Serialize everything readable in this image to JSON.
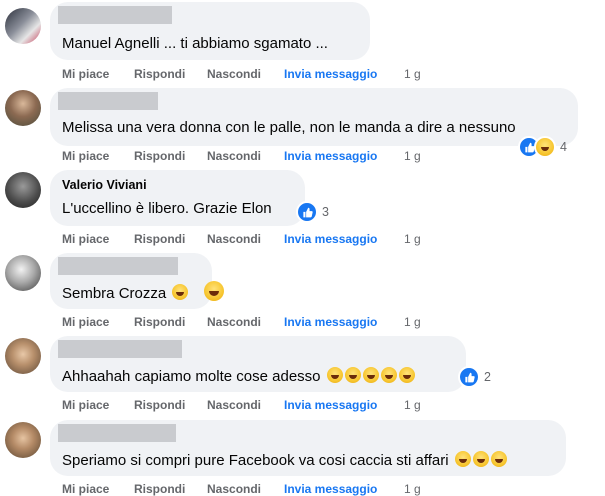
{
  "actions": {
    "like": "Mi piace",
    "reply": "Rispondi",
    "hide": "Nascondi",
    "message": "Invia messaggio",
    "time": "1 g"
  },
  "comments": [
    {
      "author": "",
      "text": "Manuel Agnelli ... ti abbiamo sgamato ...",
      "emoji_in_text": 0,
      "reactions": null
    },
    {
      "author": "",
      "text": "Melissa una vera donna con le palle, non le manda a dire a nessuno",
      "emoji_in_text": 0,
      "reactions": {
        "types": [
          "like",
          "haha"
        ],
        "count": "4"
      }
    },
    {
      "author": "Valerio Viviani",
      "text": "L'uccellino è libero. Grazie Elon",
      "emoji_in_text": 0,
      "reactions": {
        "types": [
          "like"
        ],
        "count": "3"
      }
    },
    {
      "author": "",
      "text": "Sembra Crozza",
      "emoji_in_text": 1,
      "reactions": null
    },
    {
      "author": "",
      "text": "Ahhaahah capiamo molte cose adesso",
      "emoji_in_text": 5,
      "reactions": {
        "types": [
          "like"
        ],
        "count": "2"
      }
    },
    {
      "author": "",
      "text": "Speriamo si compri pure Facebook va cosi caccia sti affari",
      "emoji_in_text": 3,
      "reactions": null
    }
  ],
  "colors": {
    "bubble": "#f0f2f5",
    "link": "#1877f2",
    "muted": "#65676b",
    "like": "#1877f2"
  }
}
